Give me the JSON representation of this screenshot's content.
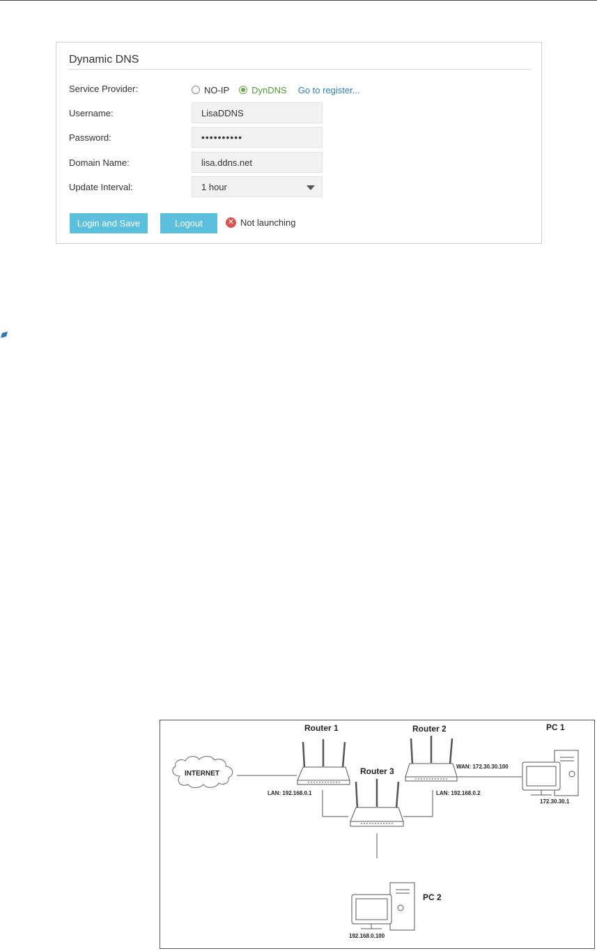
{
  "panel": {
    "title": "Dynamic DNS",
    "service_provider_label": "Service Provider:",
    "providers": [
      {
        "label": "NO-IP",
        "selected": false
      },
      {
        "label": "DynDNS",
        "selected": true
      }
    ],
    "register_link": "Go to register...",
    "username_label": "Username:",
    "username_value": "LisaDDNS",
    "password_label": "Password:",
    "password_value": "••••••••••",
    "domain_label": "Domain Name:",
    "domain_value": "lisa.ddns.net",
    "interval_label": "Update Interval:",
    "interval_value": "1 hour",
    "login_button": "Login and Save",
    "logout_button": "Logout",
    "status_text": "Not launching",
    "status_icon": "error-x-icon"
  },
  "diagram": {
    "cloud": "INTERNET",
    "router1": "Router 1",
    "router2": "Router 2",
    "router3": "Router 3",
    "pc1": "PC 1",
    "pc2": "PC 2",
    "router1_lan": "LAN: 192.168.0.1",
    "router2_lan": "LAN: 192.168.0.2",
    "router2_wan": "WAN: 172.30.30.100",
    "pc1_ip": "172.30.30.1",
    "pc2_ip": "192.168.0.100"
  },
  "colors": {
    "button": "#5bc0de",
    "selected_radio": "#6aa84f",
    "link": "#2f7fb3",
    "error": "#d9534f"
  }
}
